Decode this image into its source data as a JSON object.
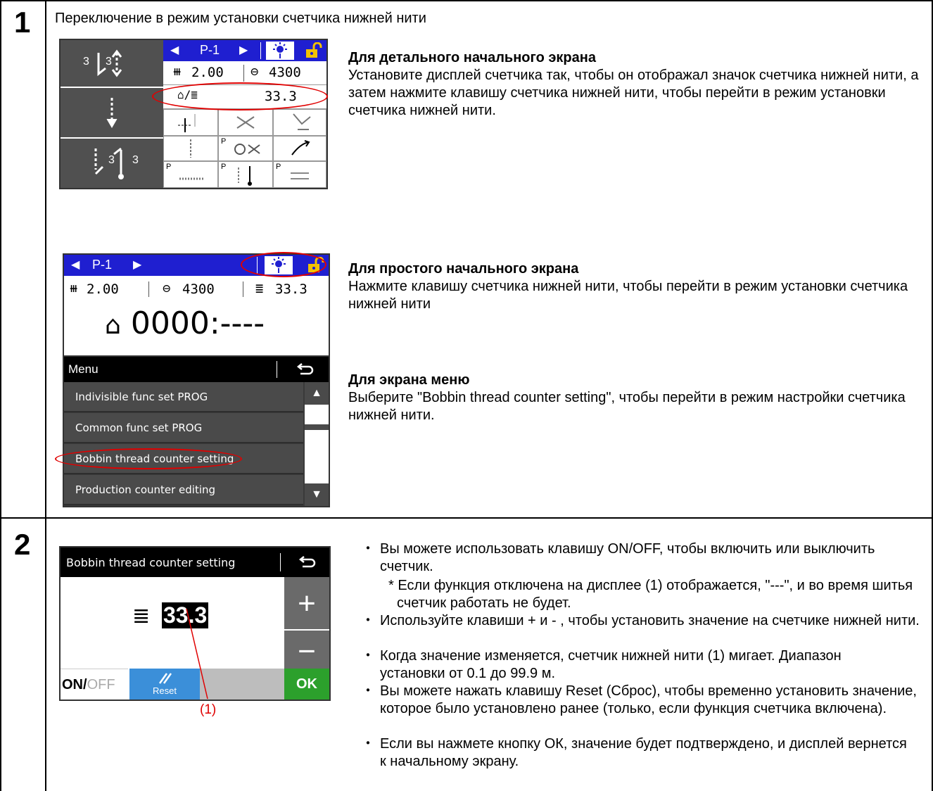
{
  "step1": {
    "num": "1",
    "heading": "Переключение в режим установки счетчика нижней нити",
    "detailed": {
      "title": "Для детального начального экрана",
      "body": "Установите дисплей счетчика так, чтобы он отображал значок счетчика нижней нити, а затем нажмите клавишу счетчика нижней нити, чтобы перейти в режим установки счетчика нижней нити.",
      "screen": {
        "pattern": "P-1",
        "pitch": "2.00",
        "speed": "4300",
        "counter": "33.3",
        "left_top_a": "3",
        "left_top_b": "3",
        "left_bot_a": "3",
        "left_bot_b": "3"
      }
    },
    "simple": {
      "title": "Для простого начального экрана",
      "body": "Нажмите клавишу счетчика нижней нити, чтобы перейти в режим установки счетчика нижней нити",
      "screen": {
        "pattern": "P-1",
        "pitch": "2.00",
        "speed": "4300",
        "counter": "33.3",
        "production": "0000:----"
      }
    },
    "menu": {
      "title": "Для экрана меню",
      "body": "Выберите \"Bobbin thread counter setting\", чтобы перейти в режим настройки счетчика нижней нити.",
      "screen": {
        "header": "Menu",
        "items": [
          "Indivisible func set PROG",
          "Common func set PROG",
          "Bobbin thread counter setting",
          "Production counter editing"
        ]
      }
    }
  },
  "step2": {
    "num": "2",
    "screen": {
      "title": "Bobbin thread counter setting",
      "value": "33.3",
      "plus": "+",
      "minus": "−",
      "on": "ON",
      "slash": "/",
      "off": "OFF",
      "reset": "Reset",
      "ok": "OK",
      "callout": "(1)"
    },
    "bullets": [
      "Вы можете использовать клавишу ON/OFF, чтобы включить или выключить счетчик.",
      "* Если функция отключена на дисплее (1) отображается, \"---\", и во время шитья счетчик работать не будет.",
      "Используйте клавиши + и - , чтобы установить значение на счетчике нижней нити.",
      "Когда значение изменяется, счетчик нижней нити (1) мигает. Диапазон установки от 0.1 до 99.9 м.",
      "Вы можете нажать клавишу Reset (Сброс), чтобы временно установить значение, которое было установлено ранее (только, если функция счетчика включена).",
      "Если вы нажмете кнопку ОК, значение будет подтверждено, и дисплей вернется к начальному экрану."
    ]
  },
  "colors": {
    "screen_blue": "#1f1fd0",
    "screen_dark": "#505050",
    "highlight_red": "#e00000",
    "ok_green": "#2ca02c",
    "reset_blue": "#3b8fd9"
  }
}
